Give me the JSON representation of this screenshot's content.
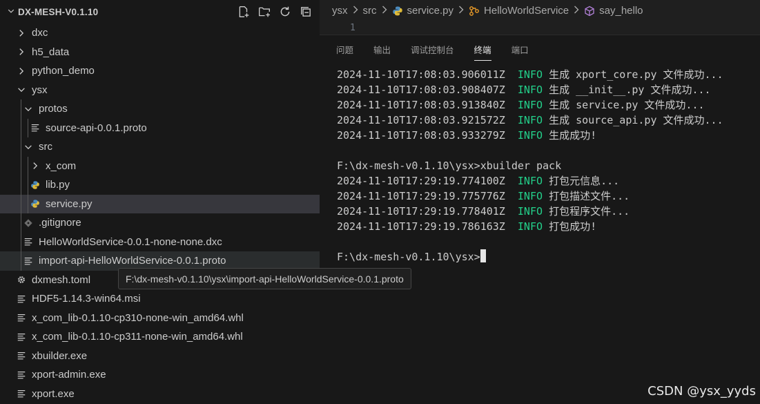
{
  "explorer": {
    "title": "DX-MESH-V0.1.10",
    "items": [
      {
        "label": "dxc",
        "depth": 0,
        "kind": "folder",
        "expanded": false
      },
      {
        "label": "h5_data",
        "depth": 0,
        "kind": "folder",
        "expanded": false
      },
      {
        "label": "python_demo",
        "depth": 0,
        "kind": "folder",
        "expanded": false
      },
      {
        "label": "ysx",
        "depth": 0,
        "kind": "folder",
        "expanded": true
      },
      {
        "label": "protos",
        "depth": 1,
        "kind": "folder",
        "expanded": true
      },
      {
        "label": "source-api-0.0.1.proto",
        "depth": 2,
        "kind": "file-lines"
      },
      {
        "label": "src",
        "depth": 1,
        "kind": "folder",
        "expanded": true
      },
      {
        "label": "x_com",
        "depth": 2,
        "kind": "folder",
        "expanded": false
      },
      {
        "label": "lib.py",
        "depth": 2,
        "kind": "python"
      },
      {
        "label": "service.py",
        "depth": 2,
        "kind": "python",
        "state": "selected"
      },
      {
        "label": ".gitignore",
        "depth": 1,
        "kind": "git"
      },
      {
        "label": "HelloWorldService-0.0.1-none-none.dxc",
        "depth": 1,
        "kind": "file-lines"
      },
      {
        "label": "import-api-HelloWorldService-0.0.1.proto",
        "depth": 1,
        "kind": "file-lines",
        "state": "hovered"
      },
      {
        "label": "dxmesh.toml",
        "depth": 0,
        "kind": "gear"
      },
      {
        "label": "HDF5-1.14.3-win64.msi",
        "depth": 0,
        "kind": "file-lines"
      },
      {
        "label": "x_com_lib-0.1.10-cp310-none-win_amd64.whl",
        "depth": 0,
        "kind": "file-lines"
      },
      {
        "label": "x_com_lib-0.1.10-cp311-none-win_amd64.whl",
        "depth": 0,
        "kind": "file-lines"
      },
      {
        "label": "xbuilder.exe",
        "depth": 0,
        "kind": "file-lines"
      },
      {
        "label": "xport-admin.exe",
        "depth": 0,
        "kind": "file-lines"
      },
      {
        "label": "xport.exe",
        "depth": 0,
        "kind": "file-lines"
      }
    ]
  },
  "breadcrumb": [
    {
      "label": "ysx",
      "icon": ""
    },
    {
      "label": "src",
      "icon": ""
    },
    {
      "label": "service.py",
      "icon": "python-icon"
    },
    {
      "label": "HelloWorldService",
      "icon": "class-icon"
    },
    {
      "label": "say_hello",
      "icon": "method-icon"
    }
  ],
  "editor": {
    "line_number": "1"
  },
  "panel": {
    "tabs": [
      {
        "label": "问题",
        "active": false
      },
      {
        "label": "输出",
        "active": false
      },
      {
        "label": "调试控制台",
        "active": false
      },
      {
        "label": "终端",
        "active": true
      },
      {
        "label": "端口",
        "active": false
      }
    ]
  },
  "terminal": {
    "lines": [
      {
        "ts": "2024-11-10T17:08:03.906011Z",
        "level": "INFO",
        "msg": "生成 xport_core.py 文件成功..."
      },
      {
        "ts": "2024-11-10T17:08:03.908407Z",
        "level": "INFO",
        "msg": "生成 __init__.py 文件成功..."
      },
      {
        "ts": "2024-11-10T17:08:03.913840Z",
        "level": "INFO",
        "msg": "生成 service.py 文件成功..."
      },
      {
        "ts": "2024-11-10T17:08:03.921572Z",
        "level": "INFO",
        "msg": "生成 source_api.py 文件成功..."
      },
      {
        "ts": "2024-11-10T17:08:03.933279Z",
        "level": "INFO",
        "msg": "生成成功!"
      },
      {
        "text": ""
      },
      {
        "text": "F:\\dx-mesh-v0.1.10\\ysx>xbuilder pack"
      },
      {
        "ts": "2024-11-10T17:29:19.774100Z",
        "level": "INFO",
        "msg": "打包元信息..."
      },
      {
        "ts": "2024-11-10T17:29:19.775776Z",
        "level": "INFO",
        "msg": "打包描述文件..."
      },
      {
        "ts": "2024-11-10T17:29:19.778401Z",
        "level": "INFO",
        "msg": "打包程序文件..."
      },
      {
        "ts": "2024-11-10T17:29:19.786163Z",
        "level": "INFO",
        "msg": "打包成功!"
      },
      {
        "text": ""
      },
      {
        "text": "F:\\dx-mesh-v0.1.10\\ysx>",
        "cursor": true
      }
    ]
  },
  "tooltip": {
    "text": "F:\\dx-mesh-v0.1.10\\ysx\\import-api-HelloWorldService-0.0.1.proto"
  },
  "watermark": "CSDN @ysx_yyds",
  "colors": {
    "info": "#23d18b",
    "python_icon": "#4b8bbe",
    "class_icon": "#ee9d28",
    "method_icon": "#b180d7"
  }
}
